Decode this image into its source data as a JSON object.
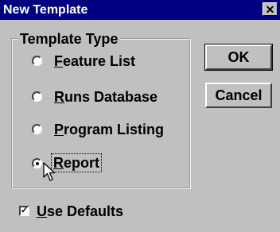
{
  "window": {
    "title": "New Template",
    "close_glyph": "✕"
  },
  "template_type": {
    "label": "Template Type",
    "options": [
      {
        "mnemonic": "F",
        "rest": "eature List",
        "checked": false
      },
      {
        "mnemonic": "R",
        "rest": "uns Database",
        "checked": false
      },
      {
        "mnemonic": "P",
        "rest": "rogram Listing",
        "checked": false
      },
      {
        "mnemonic": "R",
        "rest": "eport",
        "checked": true
      }
    ]
  },
  "buttons": {
    "ok_label": "OK",
    "cancel_label": "Cancel"
  },
  "use_defaults": {
    "mnemonic": "U",
    "rest": "se Defaults",
    "checked": true,
    "check_glyph": "✓"
  },
  "colors": {
    "titlebar": "#000080",
    "face": "#c0c0c0"
  }
}
